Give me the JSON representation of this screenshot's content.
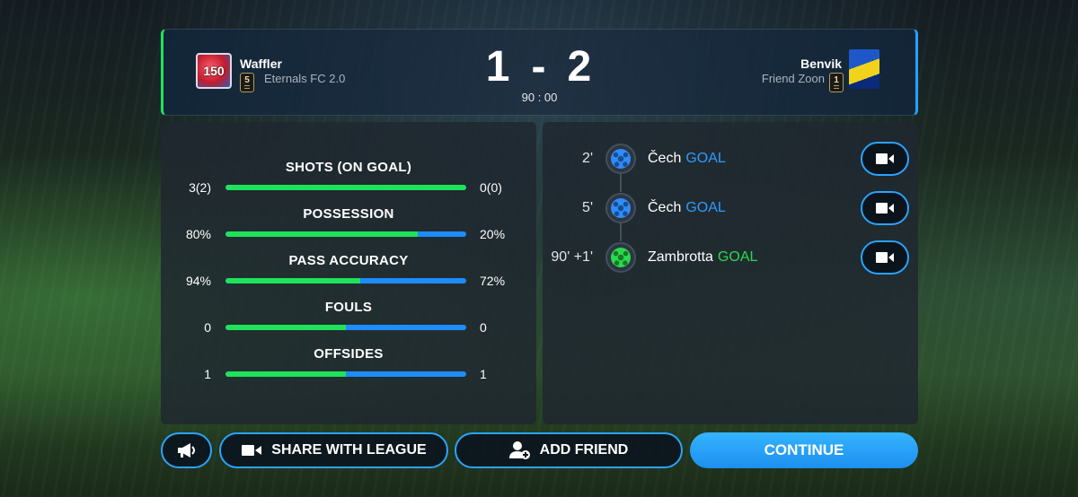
{
  "header": {
    "home": {
      "name": "Waffler",
      "club": "Eternals FC 2.0",
      "rank": "5",
      "crest_text": "150"
    },
    "away": {
      "name": "Benvik",
      "club": "Friend Zoon",
      "rank": "1"
    },
    "score_home": "1",
    "score_sep": "-",
    "score_away": "2",
    "time": "90 : 00"
  },
  "stats": [
    {
      "title": "SHOTS (ON GOAL)",
      "left": "3(2)",
      "right": "0(0)",
      "left_share": 1.0
    },
    {
      "title": "POSSESSION",
      "left": "80%",
      "right": "20%",
      "left_share": 0.8
    },
    {
      "title": "PASS ACCURACY",
      "left": "94%",
      "right": "72%",
      "left_share": 0.56
    },
    {
      "title": "FOULS",
      "left": "0",
      "right": "0",
      "left_share": 0.5
    },
    {
      "title": "OFFSIDES",
      "left": "1",
      "right": "1",
      "left_share": 0.5
    }
  ],
  "events": [
    {
      "minute": "2'",
      "player": "Čech",
      "type": "GOAL",
      "team_color": "blue"
    },
    {
      "minute": "5'",
      "player": "Čech",
      "type": "GOAL",
      "team_color": "blue"
    },
    {
      "minute": "90' +1'",
      "player": "Zambrotta",
      "type": "GOAL",
      "team_color": "green"
    }
  ],
  "buttons": {
    "megaphone_icon": "megaphone-icon",
    "share_label": "SHARE WITH LEAGUE",
    "add_friend_label": "ADD FRIEND",
    "continue_label": "CONTINUE"
  },
  "colors": {
    "home_bar": "#1ee35a",
    "away_bar": "#1e8cff",
    "accent": "#2aa3ff"
  }
}
